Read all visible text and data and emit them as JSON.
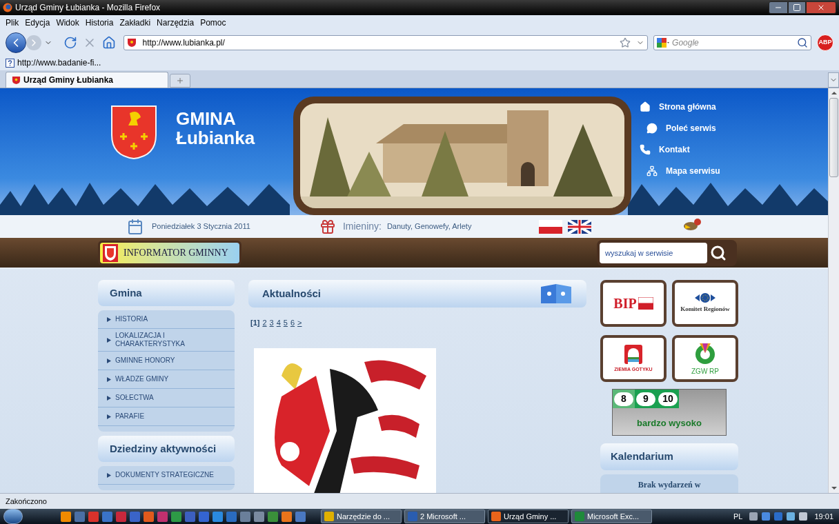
{
  "window": {
    "title": "Urząd Gminy Łubianka - Mozilla Firefox"
  },
  "menu": [
    "Plik",
    "Edycja",
    "Widok",
    "Historia",
    "Zakładki",
    "Narzędzia",
    "Pomoc"
  ],
  "address_bar": {
    "url": "http://www.lubianka.pl/"
  },
  "search_field": {
    "placeholder": "Google"
  },
  "addon_badge": "ABP",
  "bookmarks": [
    "http://www.badanie-fi..."
  ],
  "tabs": [
    {
      "label": "Urząd Gminy Łubianka",
      "selected": true
    }
  ],
  "site": {
    "logo_line_1": "GMINA",
    "logo_line_2": "Łubianka",
    "nav_links": [
      {
        "kind": "home",
        "label": "Strona główna"
      },
      {
        "kind": "chat",
        "label": "Poleć serwis"
      },
      {
        "kind": "phone",
        "label": "Kontakt"
      },
      {
        "kind": "sitemap",
        "label": "Mapa serwisu"
      }
    ],
    "date": "Poniedziałek 3 Stycznia 2011",
    "name_days_label": "Imieniny:",
    "name_days": "Danuty, Genowefy, Arlety",
    "banner": "INFORMATOR GMINNY",
    "search_placeholder": "wyszukaj w serwisie"
  },
  "sidebar": [
    {
      "title": "Gmina",
      "items": [
        "HISTORIA",
        "LOKALIZACJA I CHARAKTERYSTYKA",
        "GMINNE HONORY",
        "WŁADZE GMINY",
        "SOŁECTWA",
        "PARAFIE"
      ]
    },
    {
      "title": "Dziedziny aktywności",
      "items": [
        "DOKUMENTY STRATEGICZNE"
      ]
    }
  ],
  "news": {
    "title": "Aktualności",
    "pages": [
      {
        "label": "[1]",
        "selected": true
      },
      {
        "label": "2",
        "selected": false
      },
      {
        "label": "3",
        "selected": false
      },
      {
        "label": "4",
        "selected": false
      },
      {
        "label": "5",
        "selected": false
      },
      {
        "label": "6",
        "selected": false
      },
      {
        "label": ">",
        "selected": false
      }
    ]
  },
  "partner_logos": [
    {
      "kind": "bip",
      "label": "BIP"
    },
    {
      "kind": "eu",
      "label": "Komitet Regionów"
    },
    {
      "kind": "gothic",
      "label": "ZIEMIA GOTYKU"
    },
    {
      "kind": "zgw",
      "label": "ZGW RP"
    }
  ],
  "rating": {
    "scores": [
      "8",
      "9",
      "10"
    ],
    "caption": "bardzo wysoko"
  },
  "calendar": {
    "title": "Kalendarium",
    "message": "Brak wydarzeń w"
  },
  "status_bar": "Zakończono",
  "taskbar": {
    "items": [
      {
        "kind": "tool",
        "label": "Narzędzie do ...",
        "selected": false
      },
      {
        "kind": "word",
        "label": "2 Microsoft ...",
        "selected": false
      },
      {
        "kind": "firefox",
        "label": "Urząd Gminy ...",
        "selected": true
      },
      {
        "kind": "excel",
        "label": "Microsoft Exc...",
        "selected": false
      }
    ],
    "language": "PL",
    "clock": "19:01"
  }
}
